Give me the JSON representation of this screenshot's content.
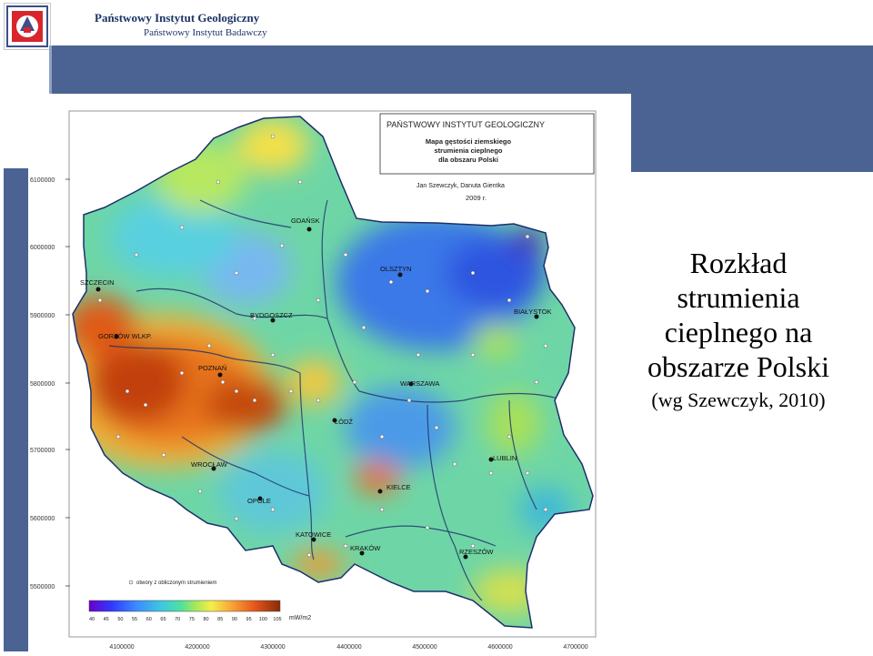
{
  "header": {
    "institute": "Państwowy Instytut Geologiczny",
    "subtitle": "Państwowy Instytut Badawczy"
  },
  "slide_title": {
    "line1": "Rozkład",
    "line2": "strumienia",
    "line3": "cieplnego na",
    "line4": "obszarze Polski",
    "line5": "(wg Szewczyk, 2010)"
  },
  "map": {
    "org": "PAŃSTWOWY INSTYTUT GEOLOGICZNY",
    "title1": "Mapa gęstości ziemskiego",
    "title2": "strumienia cieplnego",
    "title3": "dla obszaru Polski",
    "authors": "Jan Szewczyk, Danuta Gientka",
    "year": "2009 r.",
    "legend_points": "otwory z obliczonym strumieniem",
    "unit": "mW/m2",
    "legend_ticks": [
      "40",
      "45",
      "50",
      "55",
      "60",
      "65",
      "70",
      "75",
      "80",
      "85",
      "90",
      "95",
      "100",
      "105"
    ],
    "y_ticks": [
      "6100000",
      "6000000",
      "5900000",
      "5800000",
      "5700000",
      "5600000",
      "5500000"
    ],
    "x_ticks": [
      "4100000",
      "4200000",
      "4300000",
      "4400000",
      "4500000",
      "4600000",
      "4700000"
    ],
    "cities": {
      "gdansk": "GDAŃSK",
      "olsztyn": "OLSZTYN",
      "szczecin": "SZCZECIN",
      "bialystok": "BIAŁYSTOK",
      "bydgoszcz": "BYDGOSZCZ",
      "gorzow": "GORZÓW WLKP.",
      "poznan": "POZNAŃ",
      "warszawa": "WARSZAWA",
      "lodz": "ŁÓDŹ",
      "wroclaw": "WROCŁAW",
      "lublin": "LUBLIN",
      "kielce": "KIELCE",
      "opole": "OPOLE",
      "katowice": "KATOWICE",
      "krakow": "KRAKÓW",
      "rzeszow": "RZESZÓW"
    }
  },
  "colors": {
    "accent_band": "#4a6392",
    "header_text": "#1c3566"
  },
  "icons": {
    "logo": "institute-emblem-icon"
  }
}
